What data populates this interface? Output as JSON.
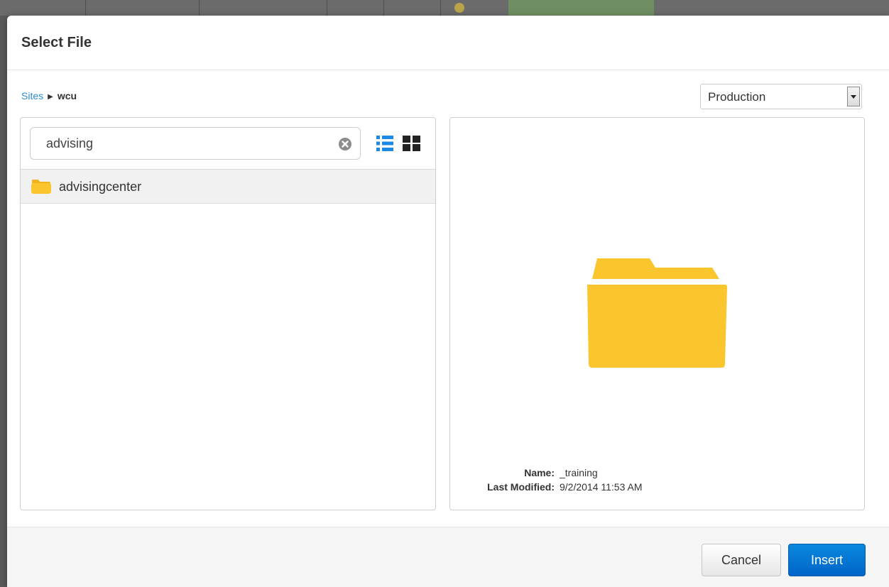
{
  "dialog": {
    "title": "Select File"
  },
  "breadcrumb": {
    "root": "Sites",
    "current": "wcu"
  },
  "environment_select": {
    "value": "Production"
  },
  "search": {
    "value": "advising"
  },
  "view_toggle": {
    "list_icon": "list-view-icon",
    "grid_icon": "grid-view-icon",
    "active": "list",
    "active_color": "#1e88e5"
  },
  "results": [
    {
      "name": "advisingcenter",
      "type": "folder"
    }
  ],
  "preview": {
    "icon": "folder-icon",
    "icon_color": "#fbc52e",
    "name_label": "Name:",
    "name_value": "_training",
    "modified_label": "Last Modified:",
    "modified_value": "9/2/2014 11:53 AM"
  },
  "footer": {
    "cancel_label": "Cancel",
    "insert_label": "Insert",
    "insert_color": "#0a7ad8"
  }
}
